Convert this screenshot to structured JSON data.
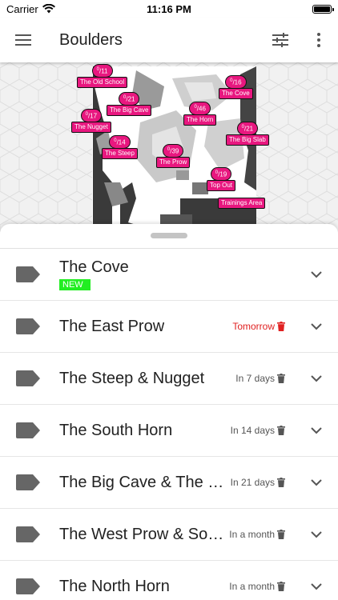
{
  "status_bar": {
    "carrier": "Carrier",
    "time": "11:16 PM"
  },
  "app_bar": {
    "title": "Boulders"
  },
  "map_markers": [
    {
      "count": "0",
      "total": "11",
      "label": "The Old School"
    },
    {
      "count": "0",
      "total": "21",
      "label": "The Big Cave"
    },
    {
      "count": "0",
      "total": "17",
      "label": "The Nugget"
    },
    {
      "count": "0",
      "total": "14",
      "label": "The Steep"
    },
    {
      "count": "0",
      "total": "46",
      "label": "The Horn"
    },
    {
      "count": "0",
      "total": "39",
      "label": "The Prow"
    },
    {
      "count": "0",
      "total": "16",
      "label": "The Cove"
    },
    {
      "count": "0",
      "total": "21",
      "label": "The Big Slab"
    },
    {
      "count": "0",
      "total": "19",
      "label": "Top Out"
    },
    {
      "count": "",
      "total": "",
      "label": "Trainings Area"
    }
  ],
  "list": [
    {
      "title": "The Cove",
      "badge": "NEW",
      "meta": ""
    },
    {
      "title": "The East Prow",
      "badge": "",
      "meta": "Tomorrow"
    },
    {
      "title": "The Steep & Nugget",
      "badge": "",
      "meta": "In 7 days"
    },
    {
      "title": "The South Horn",
      "badge": "",
      "meta": "In 14 days"
    },
    {
      "title": "The Big Cave & The Old School",
      "badge": "",
      "meta": "In 21 days"
    },
    {
      "title": "The West Prow & South Horn",
      "badge": "",
      "meta": "In a month"
    },
    {
      "title": "The North Horn",
      "badge": "",
      "meta": "In a month"
    }
  ],
  "colors": {
    "accent": "#e8177f",
    "new_badge": "#22ee22",
    "urgent": "#e02020"
  }
}
